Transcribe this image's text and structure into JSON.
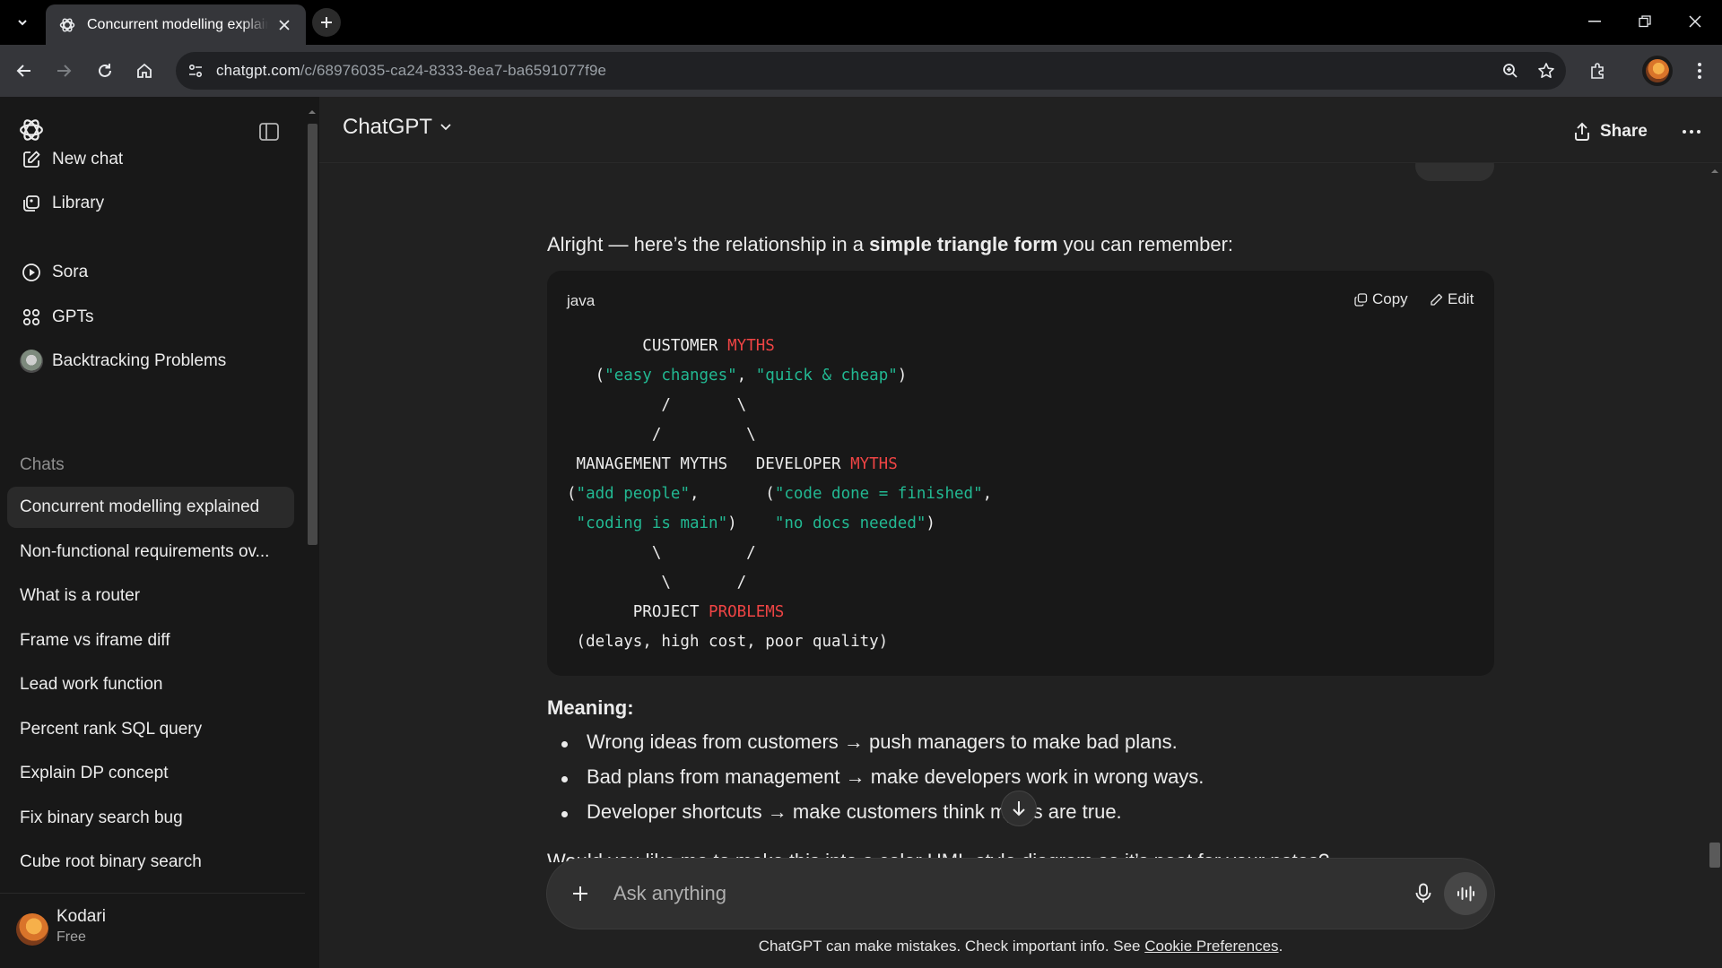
{
  "browser": {
    "tab_title": "Concurrent modelling explained",
    "url_host": "chatgpt.com",
    "url_path": "/c/68976035-ca24-8333-8ea7-ba6591077f9e"
  },
  "header": {
    "model": "ChatGPT",
    "share_label": "Share"
  },
  "sidebar": {
    "nav": [
      {
        "label": "New chat",
        "icon": "new-chat-icon"
      },
      {
        "label": "Library",
        "icon": "library-icon"
      },
      {
        "label": "Sora",
        "icon": "sora-icon"
      },
      {
        "label": "GPTs",
        "icon": "gpts-icon"
      },
      {
        "label": "Backtracking Problems",
        "icon": "gpt-avatar-icon"
      }
    ],
    "section_label": "Chats",
    "chats": [
      "Concurrent modelling explained",
      "Non-functional requirements ov...",
      "What is a router",
      "Frame vs iframe diff",
      "Lead work function",
      "Percent rank SQL query",
      "Explain DP concept",
      "Fix binary search bug",
      "Cube root binary search"
    ],
    "user": {
      "name": "Kodari",
      "plan": "Free"
    }
  },
  "message": {
    "intro_pre": "Alright — here’s the relationship in a ",
    "intro_bold": "simple triangle form",
    "intro_post": " you can remember:",
    "code": {
      "language": "java",
      "copy_label": "Copy",
      "edit_label": "Edit",
      "lines": {
        "l1a": "        CUSTOMER ",
        "l1b": "MYTHS",
        "l2a": "   (",
        "l2b": "\"easy changes\"",
        "l2c": ", ",
        "l2d": "\"quick & cheap\"",
        "l2e": ")",
        "l3": "          /       \\",
        "l4": "         /         \\",
        "l5a": " MANAGEMENT MYTHS   DEVELOPER ",
        "l5b": "MYTHS",
        "l6a": "(",
        "l6b": "\"add people\"",
        "l6c": ",       (",
        "l6d": "\"code done = finished\"",
        "l6e": ",",
        "l7a": " ",
        "l7b": "\"coding is main\"",
        "l7c": ")    ",
        "l7d": "\"no docs needed\"",
        "l7e": ")",
        "l8": "         \\         /",
        "l9": "          \\       /",
        "l10a": "       PROJECT ",
        "l10b": "PROBLEMS",
        "l11": " (delays, high cost, poor quality)"
      }
    },
    "meaning_title": "Meaning:",
    "bullets": [
      "Wrong ideas from customers → push managers to make bad plans.",
      "Bad plans from management → make developers work in wrong ways.",
      "Developer shortcuts → make customers think myths are true."
    ],
    "trailing": "Would you like me to make this into a color UML-style diagram so it’s neat for your notes?"
  },
  "composer": {
    "placeholder": "Ask anything"
  },
  "disclaimer": {
    "text": "ChatGPT can make mistakes. Check important info. See ",
    "link": "Cookie Preferences",
    "end": "."
  }
}
